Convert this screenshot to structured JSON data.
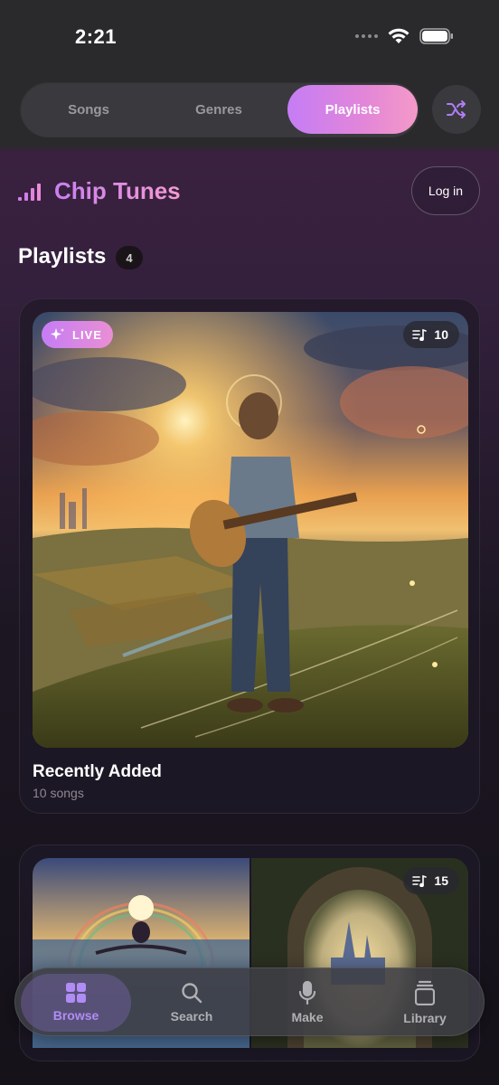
{
  "status": {
    "time": "2:21"
  },
  "segments": {
    "items": [
      "Songs",
      "Genres",
      "Playlists"
    ],
    "active": "Playlists"
  },
  "brand": {
    "title": "Chip Tunes",
    "login_label": "Log in"
  },
  "section": {
    "title": "Playlists",
    "count": "4"
  },
  "playlists": [
    {
      "title": "Recently Added",
      "subtitle": "10 songs",
      "badge": "LIVE",
      "count": "10"
    },
    {
      "count": "15"
    }
  ],
  "tabbar": {
    "items": [
      "Browse",
      "Search",
      "Make",
      "Library"
    ],
    "active": "Browse"
  },
  "colors": {
    "accent": "#c57df5",
    "accent_end": "#f59ac8",
    "background": "#2a2a2c"
  },
  "icons": [
    "signal-bars-icon",
    "wifi-icon",
    "battery-icon",
    "shuffle-icon",
    "sparkle-icon",
    "music-list-icon",
    "grid-icon",
    "search-icon",
    "microphone-icon",
    "library-icon"
  ]
}
